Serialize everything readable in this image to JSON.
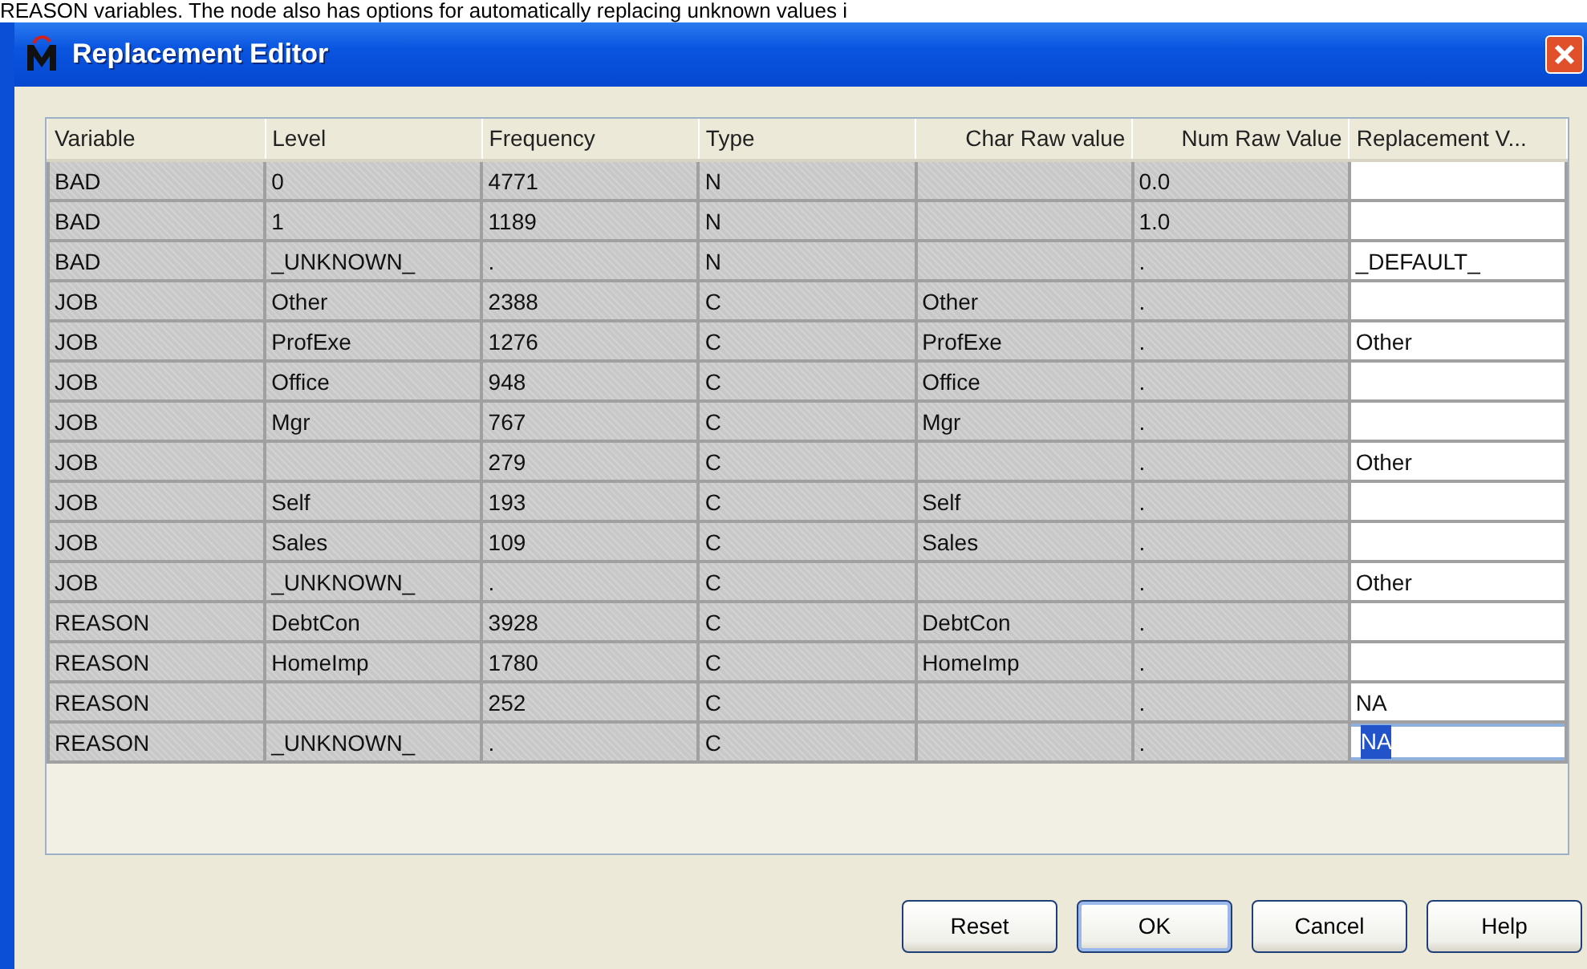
{
  "caption_fragment": "REASON variables.  The node also has options for automatically replacing unknown values i",
  "window": {
    "title": "Replacement Editor"
  },
  "table": {
    "columns": [
      "Variable",
      "Level",
      "Frequency",
      "Type",
      "Char Raw value",
      "Num Raw Value",
      "Replacement V..."
    ],
    "rows": [
      {
        "cells": [
          "BAD",
          "0",
          "4771",
          "N",
          "",
          "0.0",
          ""
        ],
        "editing": false
      },
      {
        "cells": [
          "BAD",
          "1",
          "1189",
          "N",
          "",
          "1.0",
          ""
        ],
        "editing": false
      },
      {
        "cells": [
          "BAD",
          "_UNKNOWN_",
          ".",
          "N",
          "",
          ".",
          "_DEFAULT_"
        ],
        "editing": false
      },
      {
        "cells": [
          "JOB",
          "Other",
          "2388",
          "C",
          "Other",
          ".",
          ""
        ],
        "editing": false
      },
      {
        "cells": [
          "JOB",
          "ProfExe",
          "1276",
          "C",
          "ProfExe",
          ".",
          "Other"
        ],
        "editing": false
      },
      {
        "cells": [
          "JOB",
          "Office",
          "948",
          "C",
          "Office",
          ".",
          ""
        ],
        "editing": false
      },
      {
        "cells": [
          "JOB",
          "Mgr",
          "767",
          "C",
          "Mgr",
          ".",
          ""
        ],
        "editing": false
      },
      {
        "cells": [
          "JOB",
          "",
          "279",
          "C",
          "",
          ".",
          "Other"
        ],
        "editing": false
      },
      {
        "cells": [
          "JOB",
          "Self",
          "193",
          "C",
          "Self",
          ".",
          ""
        ],
        "editing": false
      },
      {
        "cells": [
          "JOB",
          "Sales",
          "109",
          "C",
          "Sales",
          ".",
          ""
        ],
        "editing": false
      },
      {
        "cells": [
          "JOB",
          "_UNKNOWN_",
          ".",
          "C",
          "",
          ".",
          "Other"
        ],
        "editing": false
      },
      {
        "cells": [
          "REASON",
          "DebtCon",
          "3928",
          "C",
          "DebtCon",
          ".",
          ""
        ],
        "editing": false
      },
      {
        "cells": [
          "REASON",
          "HomeImp",
          "1780",
          "C",
          "HomeImp",
          ".",
          ""
        ],
        "editing": false
      },
      {
        "cells": [
          "REASON",
          "",
          "252",
          "C",
          "",
          ".",
          "NA"
        ],
        "editing": false
      },
      {
        "cells": [
          "REASON",
          "_UNKNOWN_",
          ".",
          "C",
          "",
          ".",
          "NA"
        ],
        "editing": true
      }
    ]
  },
  "buttons": [
    {
      "label": "Reset",
      "default": false
    },
    {
      "label": "OK",
      "default": true
    },
    {
      "label": "Cancel",
      "default": false
    },
    {
      "label": "Help",
      "default": false
    }
  ]
}
